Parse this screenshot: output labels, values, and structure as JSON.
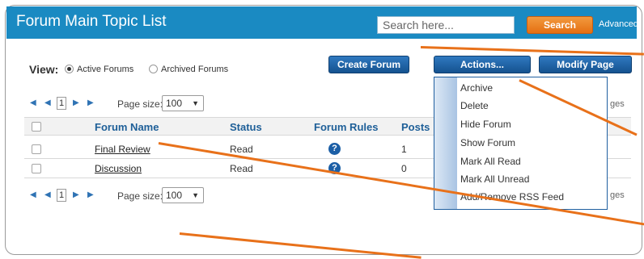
{
  "header": {
    "title": "Forum Main Topic List",
    "search_placeholder": "Search here...",
    "search_button": "Search",
    "advanced_link": "Advanced"
  },
  "view": {
    "label": "View:",
    "options": [
      "Active Forums",
      "Archived Forums"
    ],
    "selected": "Active Forums"
  },
  "toolbar": {
    "create_forum": "Create Forum",
    "actions": "Actions...",
    "modify_page": "Modify Page"
  },
  "pager": {
    "current_page": "1",
    "page_size_label": "Page size:",
    "page_size_value": "100",
    "pages_text": "ges"
  },
  "grid": {
    "columns": [
      "Forum Name",
      "Status",
      "Forum Rules",
      "Posts"
    ],
    "rows": [
      {
        "name": "Final Review",
        "status": "Read",
        "posts": "1"
      },
      {
        "name": "Discussion",
        "status": "Read",
        "posts": "0"
      }
    ]
  },
  "actions_menu": {
    "items": [
      "Archive",
      "Delete",
      "Hide Forum",
      "Show Forum",
      "Mark All Read",
      "Mark All Unread",
      "Add/Remove RSS Feed"
    ]
  },
  "icons": {
    "pager": [
      "first-page-icon",
      "prev-page-icon",
      "next-page-icon",
      "last-page-icon"
    ],
    "help": "help-icon",
    "checkbox": "checkbox-icon",
    "radio": "radio-icon"
  },
  "colors": {
    "header": "#1a8ac2",
    "accent_orange": "#e56f12",
    "button_blue": "#15528f",
    "link_blue": "#1e5f98",
    "annotation": "#e8711a"
  }
}
